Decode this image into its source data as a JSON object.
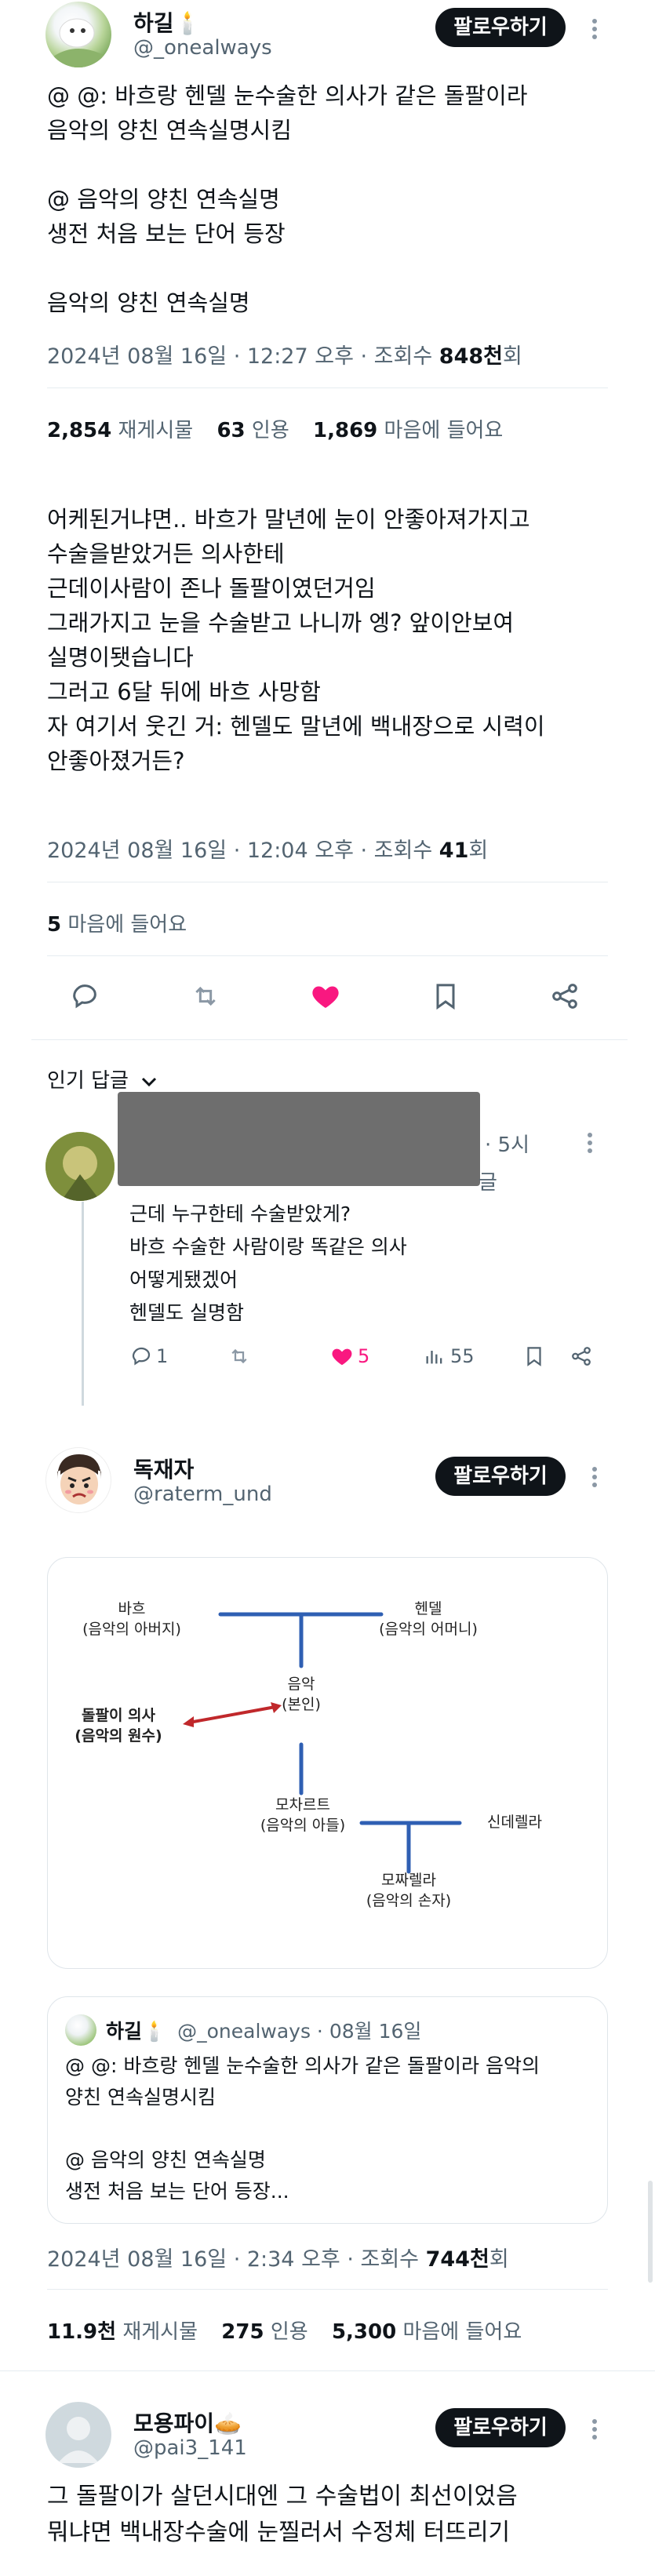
{
  "tweet1": {
    "author_name": "하길",
    "author_emoji": "🕯️",
    "author_handle": "@_onealways",
    "follow_label": "팔로우하기",
    "text": "@ @: 바흐랑 헨델 눈수술한 의사가 같은 돌팔이라\n음악의 양친 연속실명시킴\n\n@ 음악의 양친 연속실명\n생전 처음 보는 단어 등장\n\n음악의 양친 연속실명",
    "time": "2024년 08월 16일 · 12:27 오후 · 조회수 ",
    "views": "848천",
    "views_suffix": "회",
    "reposts_count": "2,854",
    "reposts_label": "재게시물",
    "quotes_count": "63",
    "quotes_label": "인용",
    "likes_count": "1,869",
    "likes_label": "마음에 들어요"
  },
  "tweet2": {
    "text": "어케된거냐면.. 바흐가 말년에 눈이 안좋아져가지고\n수술을받았거든 의사한테\n근데이사람이 존나 돌팔이였던거임\n그래가지고 눈을 수술받고 나니까 엥? 앞이안보여\n실명이됏습니다\n그러고 6달 뒤에 바흐 사망함\n자 여기서 웃긴 거: 헨델도 말년에 백내장으로 시력이\n안좋아졌거든?",
    "time": "2024년 08월 16일 · 12:04 오후 · 조회수 ",
    "views": "41",
    "views_suffix": "회",
    "likes_count": "5",
    "likes_label": "마음에 들어요"
  },
  "popular": {
    "label": "인기 답글"
  },
  "reply1": {
    "time": "· 5시",
    "partial_text": "글",
    "text": "근데 누구한테 수술받았게?\n바흐 수술한 사람이랑 똑같은 의사\n어떻게됐겠어\n헨델도 실명함",
    "replies": "1",
    "likes": "5",
    "views": "55"
  },
  "tweet3": {
    "author_name": "독재자",
    "author_handle": "@raterm_und",
    "follow_label": "팔로우하기",
    "time": "2024년 08월 16일 · 2:34 오후 · 조회수 ",
    "views": "744천",
    "views_suffix": "회",
    "reposts_count": "11.9천",
    "reposts_label": "재게시물",
    "quotes_count": "275",
    "quotes_label": "인용",
    "likes_count": "5,300",
    "likes_label": "마음에 들어요"
  },
  "diagram": {
    "bach": "바흐\n(음악의 아버지)",
    "handel": "헨델\n(음악의 어머니)",
    "music": "음악\n(본인)",
    "doctor": "돌팔이 의사\n(음악의 원수)",
    "mozart": "모차르트\n(음악의 아들)",
    "cinderella": "신데렐라",
    "mozzarella": "모짜렐라\n(음악의 손자)"
  },
  "quote": {
    "author_name": "하길",
    "author_emoji": "🕯️",
    "author_handle": "@_onealways · 08월 16일",
    "text": "@ @: 바흐랑 헨델 눈수술한 의사가 같은 돌팔이라 음악의\n양친 연속실명시킴\n\n@ 음악의 양친 연속실명\n생전 처음 보는 단어 등장..."
  },
  "tweet4": {
    "author_name": "모용파이",
    "author_emoji": "🥧",
    "author_handle": "@pai3_141",
    "follow_label": "팔로우하기",
    "text": "그 돌팔이가 살던시대엔 그 수술법이 최선이었음\n뭐냐면 백내장수술에 눈찔러서 수정체 터뜨리기"
  },
  "colors": {
    "like_pink": "#f91880",
    "text": "#0f1419",
    "secondary": "#536471",
    "diagram_blue": "#2f5fb3",
    "diagram_red": "#c0282b"
  }
}
